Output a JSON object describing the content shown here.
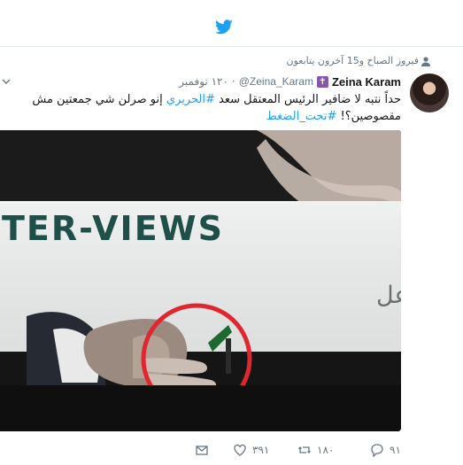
{
  "topbar": {
    "logo_icon": "twitter-bird-icon"
  },
  "tweet": {
    "social_context": "فيروز الصباح و15 آخرون يتابعون",
    "author_name": "Zeina Karam",
    "badge_glyph": "✝",
    "handle": "@Zeina_Karam",
    "separator": "·",
    "date": "١٢٠ نوفمبر",
    "text_part1": "حداً نتبه لا ضافير الرئيس المعتقل سعد ",
    "hashtag1": "#الحريري",
    "text_part2": " إنو صرلن شي جمعتين مش مقصوصين؟! ",
    "hashtag2": "#تحت_الضغط",
    "media": {
      "banner_text": "TER-VIEWS",
      "arabic_caption": "أي بالنفس وفق ما تم التوافق عل"
    },
    "actions": {
      "reply_count": "٩١",
      "retweet_count": "١٨٠",
      "like_count": "٣٩١"
    }
  },
  "colors": {
    "twitter_blue": "#1da1f2",
    "muted_text": "#657786",
    "badge_purple": "#8a56ac",
    "circle_red": "#e0262f"
  }
}
